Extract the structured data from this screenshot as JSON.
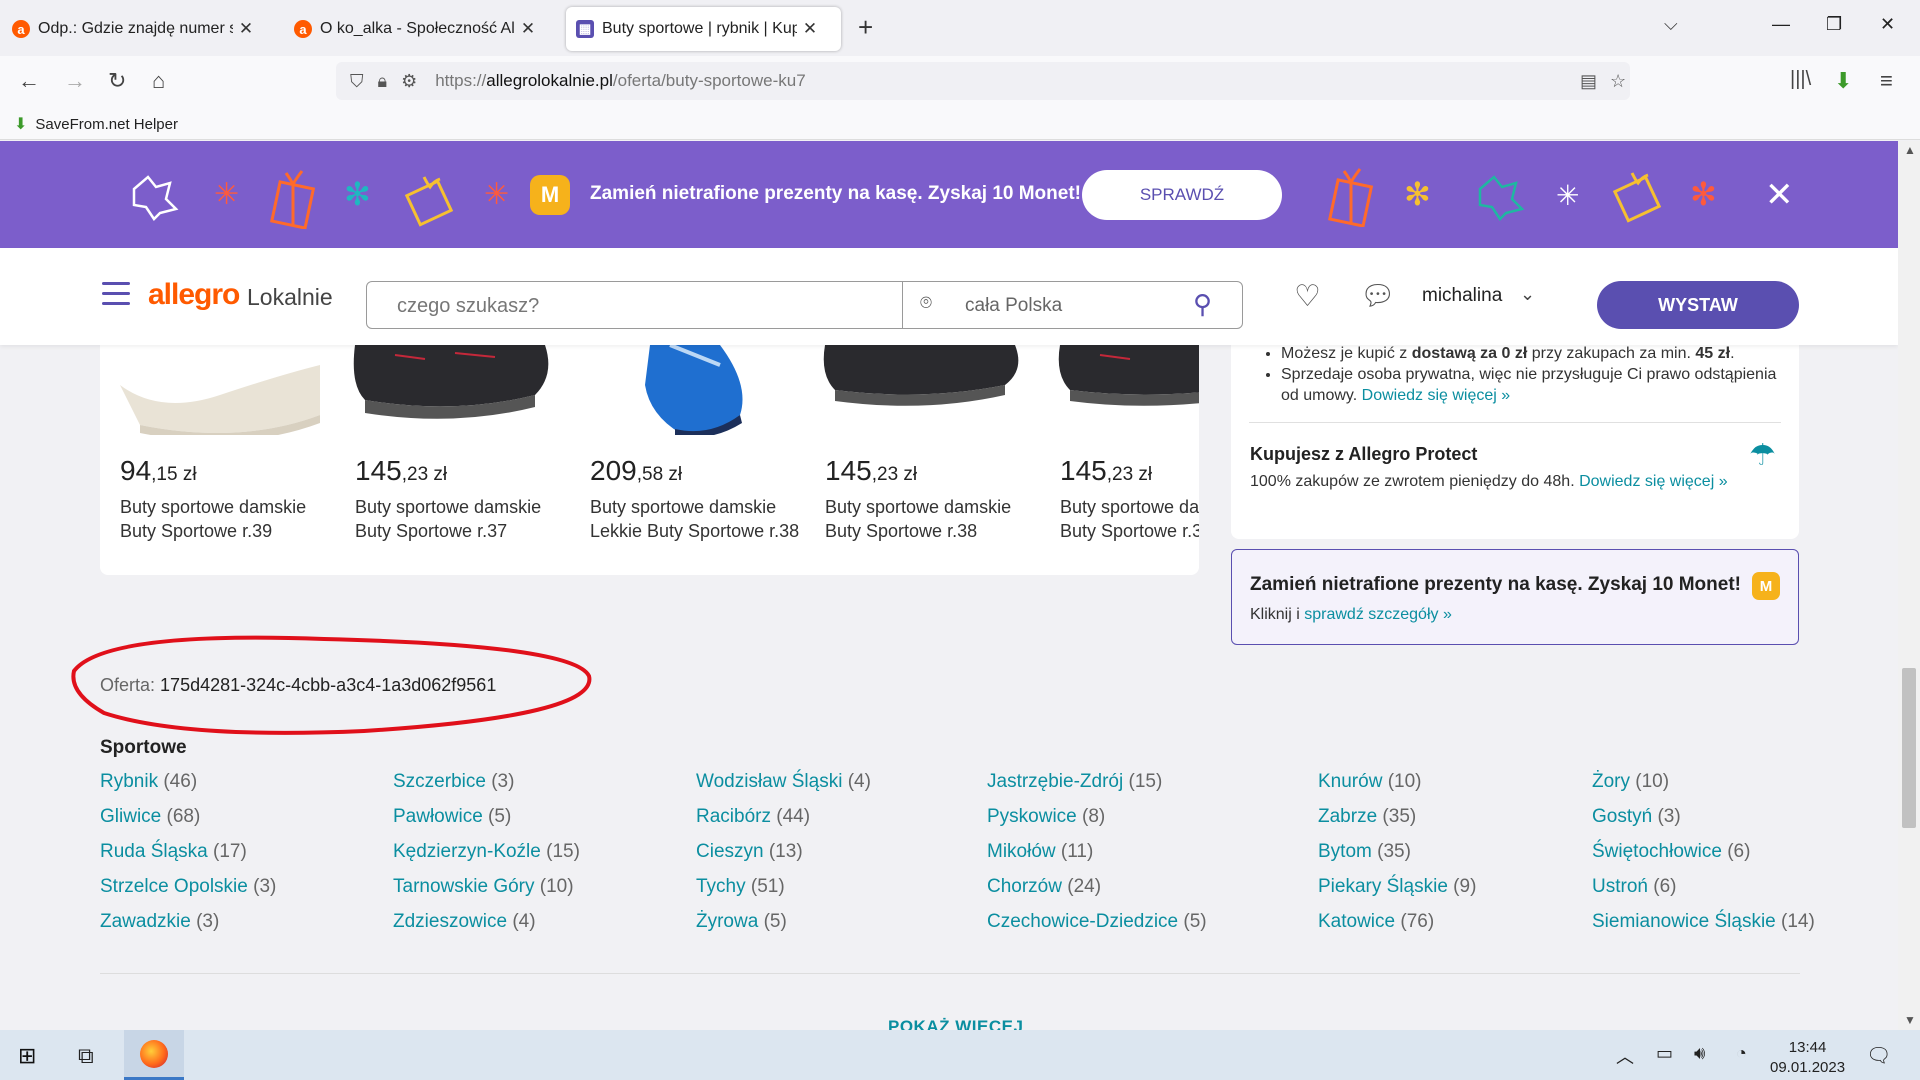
{
  "browser": {
    "tabs": [
      {
        "title": "Odp.: Gdzie znajdę numer swoje",
        "icon": "allegro-a"
      },
      {
        "title": "O ko_alka - Społeczność Allegro",
        "icon": "allegro-a"
      },
      {
        "title": "Buty sportowe | rybnik | Kup ten",
        "icon": "allegro-lokalnie",
        "active": true
      }
    ],
    "url_prefix": "https://",
    "url_host": "allegrolokalnie.pl",
    "url_path": "/oferta/buty-sportowe-ku7",
    "bookmark": "SaveFrom.net Helper"
  },
  "promo": {
    "text": "Zamień nietrafione prezenty na kasę. Zyskaj 10 Monet!",
    "button": "SPRAWDŹ",
    "coin": "M"
  },
  "header": {
    "logo": "allegro",
    "logo_sub": "Lokalnie",
    "search_placeholder": "czego szukasz?",
    "location_placeholder": "cała Polska",
    "username": "michalina",
    "cta": "WYSTAW"
  },
  "products": [
    {
      "price_main": "94",
      "price_dec": ",15 zł",
      "name1": "Buty sportowe damskie",
      "name2": "Buty Sportowe r.39"
    },
    {
      "price_main": "145",
      "price_dec": ",23 zł",
      "name1": "Buty sportowe damskie",
      "name2": "Buty Sportowe r.37"
    },
    {
      "price_main": "209",
      "price_dec": ",58 zł",
      "name1": "Buty sportowe damskie",
      "name2": "Lekkie Buty Sportowe r.38"
    },
    {
      "price_main": "145",
      "price_dec": ",23 zł",
      "name1": "Buty sportowe damskie",
      "name2": "Buty Sportowe r.38"
    },
    {
      "price_main": "145",
      "price_dec": ",23 zł",
      "name1": "Buty sportowe da",
      "name2": "Buty Sportowe r.3"
    }
  ],
  "info": {
    "bullet1_pre": "Możesz je kupić z ",
    "bullet1_bold": "dostawą za 0 zł",
    "bullet1_mid": " przy zakupach za min. ",
    "bullet1_bold2": "45 zł",
    "bullet1_end": ".",
    "bullet2": "Sprzedaje osoba prywatna, więc nie przysługuje Ci prawo odstąpienia od umowy.",
    "more_link": "Dowiedz się więcej »",
    "protect_title": "Kupujesz z Allegro Protect",
    "protect_text": "100% zakupów ze zwrotem pieniędzy do 48h.",
    "protect_link": "Dowiedz się więcej »"
  },
  "promo_box": {
    "title": "Zamień nietrafione prezenty na kasę. Zyskaj 10 Monet!",
    "sub_pre": "Kliknij i ",
    "sub_link": "sprawdź szczegóły »",
    "coin": "M"
  },
  "offer": {
    "label": "Oferta:",
    "id": "175d4281-324c-4cbb-a3c4-1a3d062f9561"
  },
  "categories": {
    "title": "Sportowe",
    "columns": [
      [
        {
          "name": "Rybnik",
          "count": "(46)"
        },
        {
          "name": "Gliwice",
          "count": "(68)"
        },
        {
          "name": "Ruda Śląska",
          "count": "(17)"
        },
        {
          "name": "Strzelce Opolskie",
          "count": "(3)"
        },
        {
          "name": "Zawadzkie",
          "count": "(3)"
        }
      ],
      [
        {
          "name": "Szczerbice",
          "count": "(3)"
        },
        {
          "name": "Pawłowice",
          "count": "(5)"
        },
        {
          "name": "Kędzierzyn-Koźle",
          "count": "(15)"
        },
        {
          "name": "Tarnowskie Góry",
          "count": "(10)"
        },
        {
          "name": "Zdzieszowice",
          "count": "(4)"
        }
      ],
      [
        {
          "name": "Wodzisław Śląski",
          "count": "(4)"
        },
        {
          "name": "Racibórz",
          "count": "(44)"
        },
        {
          "name": "Cieszyn",
          "count": "(13)"
        },
        {
          "name": "Tychy",
          "count": "(51)"
        },
        {
          "name": "Żyrowa",
          "count": "(5)"
        }
      ],
      [
        {
          "name": "Jastrzębie-Zdrój",
          "count": "(15)"
        },
        {
          "name": "Pyskowice",
          "count": "(8)"
        },
        {
          "name": "Mikołów",
          "count": "(11)"
        },
        {
          "name": "Chorzów",
          "count": "(24)"
        },
        {
          "name": "Czechowice-Dziedzice",
          "count": "(5)"
        }
      ],
      [
        {
          "name": "Knurów",
          "count": "(10)"
        },
        {
          "name": "Zabrze",
          "count": "(35)"
        },
        {
          "name": "Bytom",
          "count": "(35)"
        },
        {
          "name": "Piekary Śląskie",
          "count": "(9)"
        },
        {
          "name": "Katowice",
          "count": "(76)"
        }
      ],
      [
        {
          "name": "Żory",
          "count": "(10)"
        },
        {
          "name": "Gostyń",
          "count": "(3)"
        },
        {
          "name": "Świętochłowice",
          "count": "(6)"
        },
        {
          "name": "Ustroń",
          "count": "(6)"
        },
        {
          "name": "Siemianowice Śląskie",
          "count": "(14)"
        }
      ]
    ],
    "show_more": "POKAŻ WIĘCEJ"
  },
  "taskbar": {
    "time": "13:44",
    "date": "09.01.2023"
  },
  "colors": {
    "promo_bg": "#7c5ecb",
    "brand_purple": "#5a4fb0",
    "allegro_orange": "#ff5a00",
    "link_teal": "#0b8ea0",
    "annotation_red": "#e0101a"
  }
}
